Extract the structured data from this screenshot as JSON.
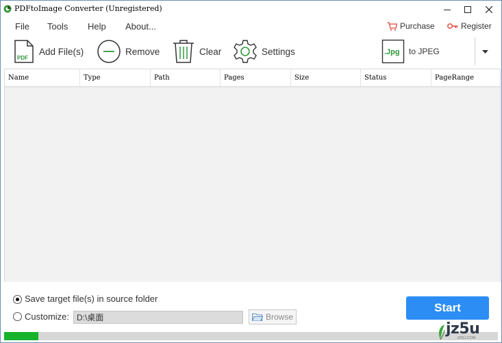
{
  "window": {
    "title": "PDFtoImage Converter (Unregistered)"
  },
  "menu": {
    "file": "File",
    "tools": "Tools",
    "help": "Help",
    "about": "About..."
  },
  "top_links": {
    "purchase": "Purchase",
    "register": "Register"
  },
  "toolbar": {
    "add_files": "Add File(s)",
    "add_files_icon_text": "PDF",
    "remove": "Remove",
    "clear": "Clear",
    "settings": "Settings",
    "format_icon_text": ".Jpg",
    "format_label": "to JPEG"
  },
  "table": {
    "columns": [
      "Name",
      "Type",
      "Path",
      "Pages",
      "Size",
      "Status",
      "PageRange"
    ],
    "rows": []
  },
  "output": {
    "option_source": "Save target file(s) in source folder",
    "option_customize": "Customize:",
    "selected": "source",
    "path_value": "D:\\桌面",
    "browse_label": "Browse"
  },
  "actions": {
    "start_label": "Start"
  },
  "progress": {
    "fraction": 0.07
  },
  "watermark": {
    "main": "jz5u",
    "sub": "JZ5U.COM"
  },
  "colors": {
    "accent": "#2c8ef5",
    "progress": "#16b32b",
    "purchase_icon": "#e0463a",
    "register_icon": "#e0463a",
    "jpg_icon": "#2f9a3a"
  }
}
